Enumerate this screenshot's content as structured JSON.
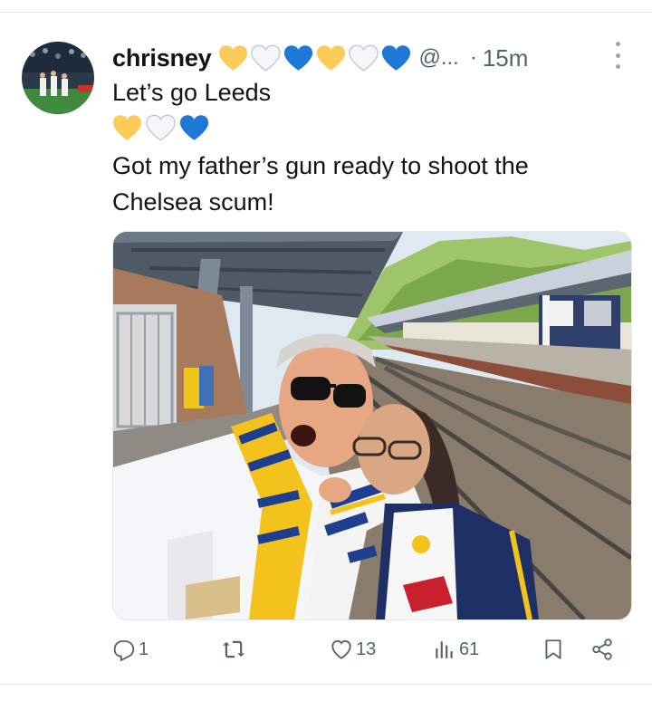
{
  "tweet": {
    "display_name": "chrisney",
    "name_emoji": [
      "yellow-heart",
      "white-heart",
      "blue-heart",
      "yellow-heart",
      "white-heart",
      "blue-heart"
    ],
    "handle": "@...",
    "separator": "·",
    "time": "15m",
    "text_line_1": "Let’s go Leeds",
    "text_emoji": [
      "yellow-heart",
      "white-heart",
      "blue-heart"
    ],
    "text_line_3": "Got my father’s gun ready to shoot the",
    "text_line_4": "Chelsea scum!"
  },
  "actions": {
    "replies": "1",
    "retweets": "",
    "likes": "13",
    "views": "61"
  },
  "icons": {
    "avatar": "avatar-photo",
    "more": "more-icon",
    "reply": "reply-icon",
    "retweet": "retweet-icon",
    "like": "like-icon",
    "views": "views-icon",
    "bookmark": "bookmark-icon",
    "share": "share-icon"
  },
  "colors": {
    "yellow_heart": "#fdcb58",
    "white_heart": "#e6e7e8",
    "blue_heart": "#1d78d6",
    "secondary_text": "#536471"
  }
}
